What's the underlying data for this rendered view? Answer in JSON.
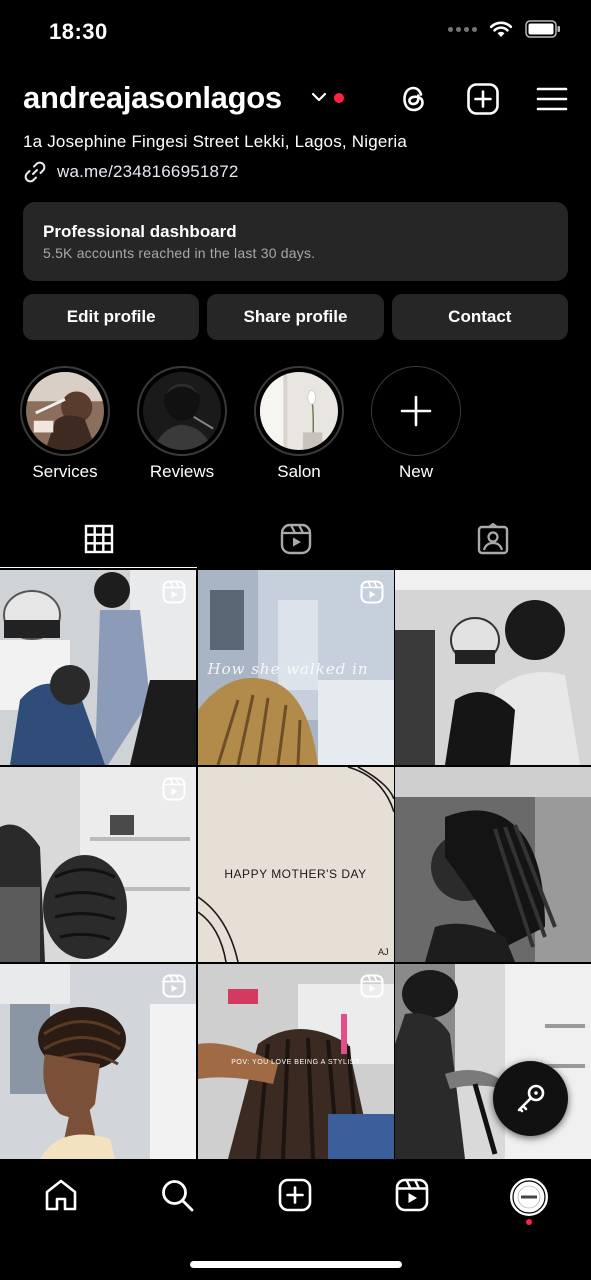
{
  "status_bar": {
    "time": "18:30"
  },
  "header": {
    "username": "andreajasonlagos",
    "icons": [
      "chevron-down-icon",
      "threads-icon",
      "add-post-icon",
      "menu-icon"
    ]
  },
  "profile": {
    "address": "1a Josephine Fingesi Street Lekki, Lagos, Nigeria",
    "link": "wa.me/2348166951872"
  },
  "dashboard": {
    "title": "Professional dashboard",
    "subtitle": "5.5K accounts reached in the last 30 days."
  },
  "buttons": {
    "edit": "Edit profile",
    "share": "Share profile",
    "contact": "Contact"
  },
  "highlights": [
    {
      "label": "Services"
    },
    {
      "label": "Reviews"
    },
    {
      "label": "Salon"
    },
    {
      "label": "New"
    }
  ],
  "tabs": [
    "grid-icon",
    "reels-icon",
    "tagged-icon"
  ],
  "posts": [
    {
      "type": "reel",
      "overlay": ""
    },
    {
      "type": "reel",
      "overlay": "How she walked in"
    },
    {
      "type": "photo",
      "overlay": ""
    },
    {
      "type": "reel",
      "overlay": ""
    },
    {
      "type": "photo",
      "overlay": "HAPPY MOTHER'S DAY",
      "watermark": "AJ"
    },
    {
      "type": "photo",
      "overlay": ""
    },
    {
      "type": "reel",
      "overlay": ""
    },
    {
      "type": "reel",
      "overlay": "POV: YOU LOVE BEING A STYLIST"
    },
    {
      "type": "photo",
      "overlay": ""
    }
  ],
  "nav": [
    "home-icon",
    "search-icon",
    "create-icon",
    "reels-icon",
    "profile-avatar"
  ],
  "colors": {
    "background": "#000000",
    "card": "#262626",
    "accent_red": "#ff2244"
  }
}
